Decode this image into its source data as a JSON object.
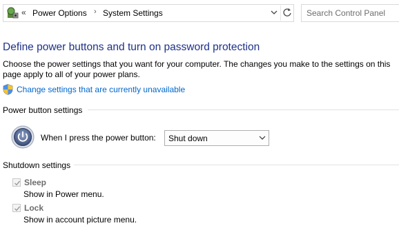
{
  "addressbar": {
    "back_chevrons": "«",
    "breadcrumb": [
      "Power Options",
      "System Settings"
    ],
    "separator": "›"
  },
  "search": {
    "placeholder": "Search Control Panel"
  },
  "main": {
    "title": "Define power buttons and turn on password protection",
    "description": "Choose the power settings that you want for your computer. The changes you make to the settings on this page apply to all of your power plans.",
    "change_link": "Change settings that are currently unavailable",
    "power_button_section": {
      "heading": "Power button settings",
      "label": "When I press the power button:",
      "selected": "Shut down"
    },
    "shutdown_section": {
      "heading": "Shutdown settings",
      "items": [
        {
          "label": "Sleep",
          "description": "Show in Power menu.",
          "checked": true,
          "enabled": false
        },
        {
          "label": "Lock",
          "description": "Show in account picture menu.",
          "checked": true,
          "enabled": false
        }
      ]
    }
  },
  "icons": {
    "control_panel": "control-panel-icon",
    "dropdown": "chevron-down-icon",
    "refresh": "refresh-icon",
    "shield": "uac-shield-icon",
    "power": "power-icon",
    "check": "checkmark-icon"
  },
  "colors": {
    "title": "#1e3287",
    "link": "#0066cc",
    "disabled_label": "#6d6d6d"
  }
}
